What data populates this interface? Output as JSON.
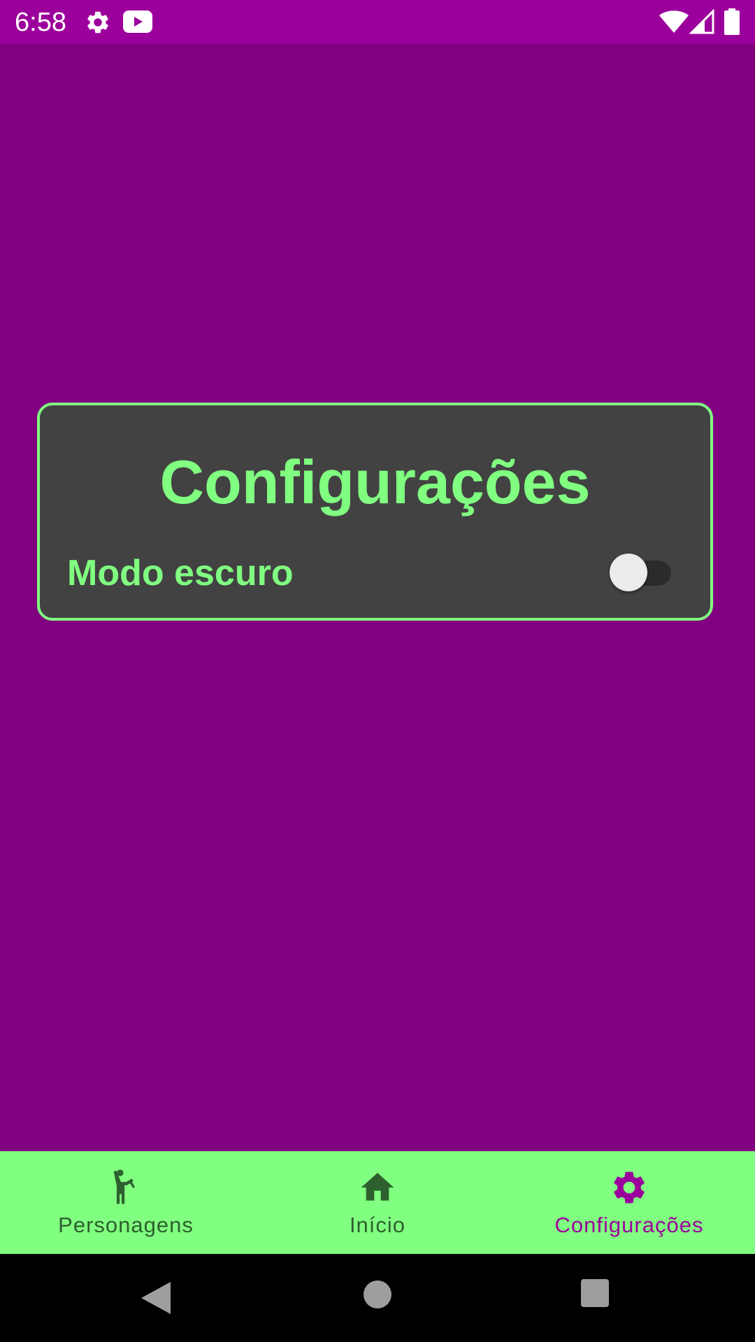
{
  "status_bar": {
    "time": "6:58",
    "icons": [
      "gear-icon",
      "youtube-icon",
      "wifi-icon",
      "signal-icon",
      "battery-icon"
    ]
  },
  "settings_card": {
    "title": "Configurações",
    "dark_mode_label": "Modo escuro",
    "dark_mode_enabled": false
  },
  "bottom_nav": {
    "items": [
      {
        "label": "Personagens",
        "icon": "person-waving-icon",
        "active": false
      },
      {
        "label": "Início",
        "icon": "home-icon",
        "active": false
      },
      {
        "label": "Configurações",
        "icon": "gear-icon",
        "active": true
      }
    ]
  },
  "system_nav": {
    "buttons": [
      "back",
      "home",
      "recents"
    ]
  },
  "colors": {
    "background": "#800080",
    "status_bar": "#9c009c",
    "card_background": "#424242",
    "accent_green": "#80ff80",
    "nav_inactive": "#2e5f2e",
    "nav_active": "#9c009c"
  }
}
